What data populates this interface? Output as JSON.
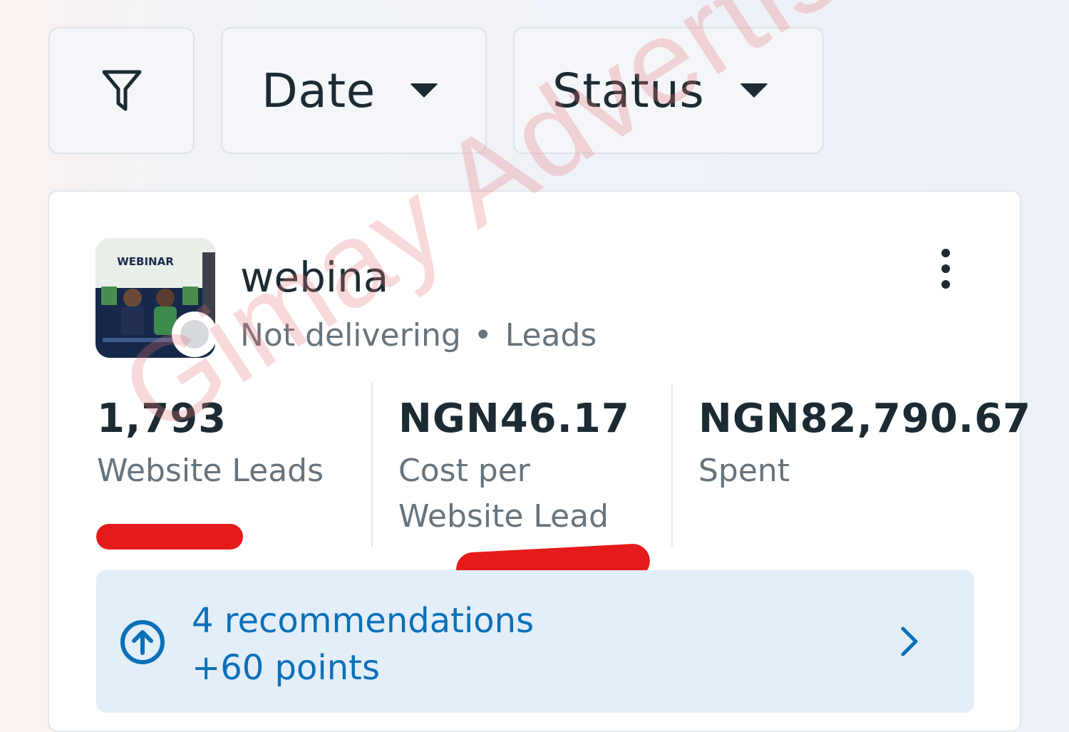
{
  "filters": {
    "filter_icon": "filter-funnel-icon",
    "date_label": "Date",
    "status_label": "Status"
  },
  "campaign": {
    "name": "webina",
    "thumbnail_text": "WEBINAR",
    "delivery_status": "Not delivering",
    "separator": "•",
    "objective": "Leads"
  },
  "metrics": [
    {
      "value": "1,793",
      "label": "Website Leads"
    },
    {
      "value": "NGN46.17",
      "label": "Cost per Website Lead"
    },
    {
      "value": "NGN82,790.67",
      "label": "Spent"
    }
  ],
  "recommendations": {
    "title": "4 recommendations",
    "points": "+60 points",
    "icon": "arrow-up-circle-icon"
  },
  "watermark": "Gimay Advertising",
  "colors": {
    "accent": "#0a70b8",
    "text_primary": "#1c2b33",
    "text_secondary": "#67737d",
    "scribble": "#e51a1a",
    "watermark": "#e67878"
  }
}
